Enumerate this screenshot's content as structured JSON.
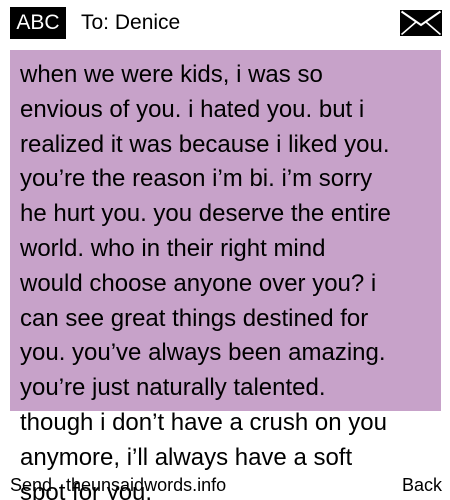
{
  "header": {
    "mode_label": "ABC",
    "recipient": "To: Denice",
    "mail_icon": "envelope-icon"
  },
  "message": {
    "lines": [
      "when we were kids, i was so",
      "envious of you. i hated you. but i",
      "realized it was because i liked you.",
      "you’re the reason i’m bi. i’m sorry",
      "he hurt you. you deserve the entire",
      "world. who in their right mind",
      "would choose anyone over you? i",
      "can see great things destined for",
      "you. you’ve always been amazing.",
      "you’re just naturally talented.",
      "though i don’t have a crush on you",
      "anymore, i’ll always have a soft",
      "spot for you."
    ],
    "background_color": "#c7a2c9"
  },
  "footer": {
    "left_softkey": "Send",
    "watermark": "theunsaidwords.info",
    "right_softkey": "Back"
  }
}
